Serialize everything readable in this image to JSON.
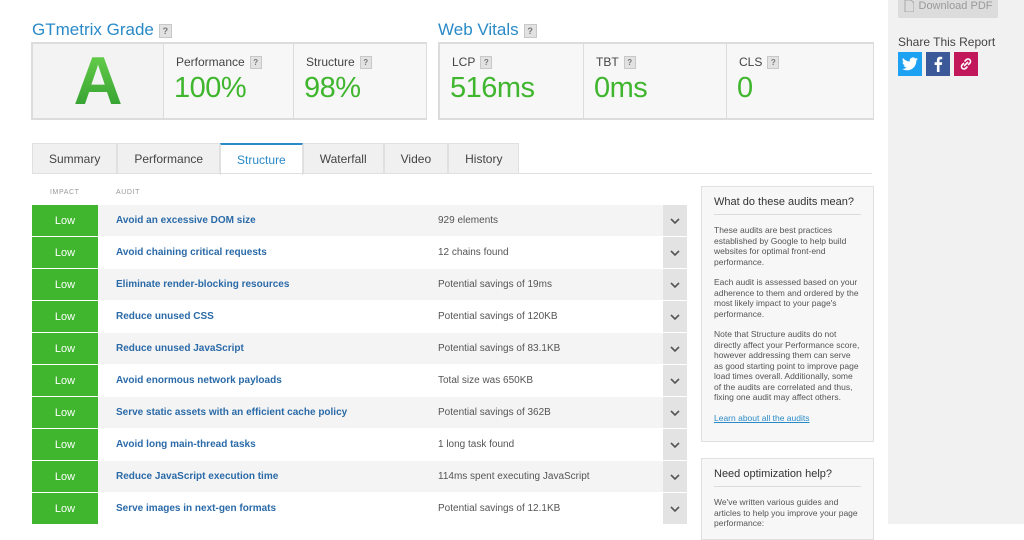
{
  "grade": {
    "title": "GTmetrix Grade",
    "help": "?",
    "letter": "A",
    "performance": {
      "label": "Performance",
      "value": "100%"
    },
    "structure": {
      "label": "Structure",
      "value": "98%"
    }
  },
  "vitals": {
    "title": "Web Vitals",
    "help": "?",
    "lcp": {
      "label": "LCP",
      "value": "516ms"
    },
    "tbt": {
      "label": "TBT",
      "value": "0ms"
    },
    "cls": {
      "label": "CLS",
      "value": "0"
    }
  },
  "sidebar": {
    "download_label": "Download PDF",
    "share_label": "Share This Report"
  },
  "tabs": [
    {
      "label": "Summary"
    },
    {
      "label": "Performance"
    },
    {
      "label": "Structure"
    },
    {
      "label": "Waterfall"
    },
    {
      "label": "Video"
    },
    {
      "label": "History"
    }
  ],
  "table": {
    "impact_header": "IMPACT",
    "audit_header": "AUDIT"
  },
  "audits": [
    {
      "impact": "Low",
      "name": "Avoid an excessive DOM size",
      "detail": "929 elements"
    },
    {
      "impact": "Low",
      "name": "Avoid chaining critical requests",
      "detail": "12 chains found"
    },
    {
      "impact": "Low",
      "name": "Eliminate render-blocking resources",
      "detail": "Potential savings of 19ms"
    },
    {
      "impact": "Low",
      "name": "Reduce unused CSS",
      "detail": "Potential savings of 120KB"
    },
    {
      "impact": "Low",
      "name": "Reduce unused JavaScript",
      "detail": "Potential savings of 83.1KB"
    },
    {
      "impact": "Low",
      "name": "Avoid enormous network payloads",
      "detail": "Total size was 650KB"
    },
    {
      "impact": "Low",
      "name": "Serve static assets with an efficient cache policy",
      "detail": "Potential savings of 362B"
    },
    {
      "impact": "Low",
      "name": "Avoid long main-thread tasks",
      "detail": "1 long task found"
    },
    {
      "impact": "Low",
      "name": "Reduce JavaScript execution time",
      "detail": "114ms spent executing JavaScript"
    },
    {
      "impact": "Low",
      "name": "Serve images in next-gen formats",
      "detail": "Potential savings of 12.1KB"
    }
  ],
  "info_box": {
    "title": "What do these audits mean?",
    "p1": "These audits are best practices established by Google to help build websites for optimal front-end performance.",
    "p2": "Each audit is assessed based on your adherence to them and ordered by the most likely impact to your page's performance.",
    "p3": "Note that Structure audits do not directly affect your Performance score, however addressing them can serve as good starting point to improve page load times overall. Additionally, some of the audits are correlated and thus, fixing one audit may affect others.",
    "link": "Learn about all the audits"
  },
  "help_box": {
    "title": "Need optimization help?",
    "body": "We've written various guides and articles to help you improve your page performance:"
  },
  "colors": {
    "accent": "#2a8ac8",
    "grade_green": "#3fb62e",
    "impact_low": "#3fb62e",
    "twitter": "#1da1f2",
    "facebook": "#3b5998",
    "link_share": "#c2185b"
  }
}
